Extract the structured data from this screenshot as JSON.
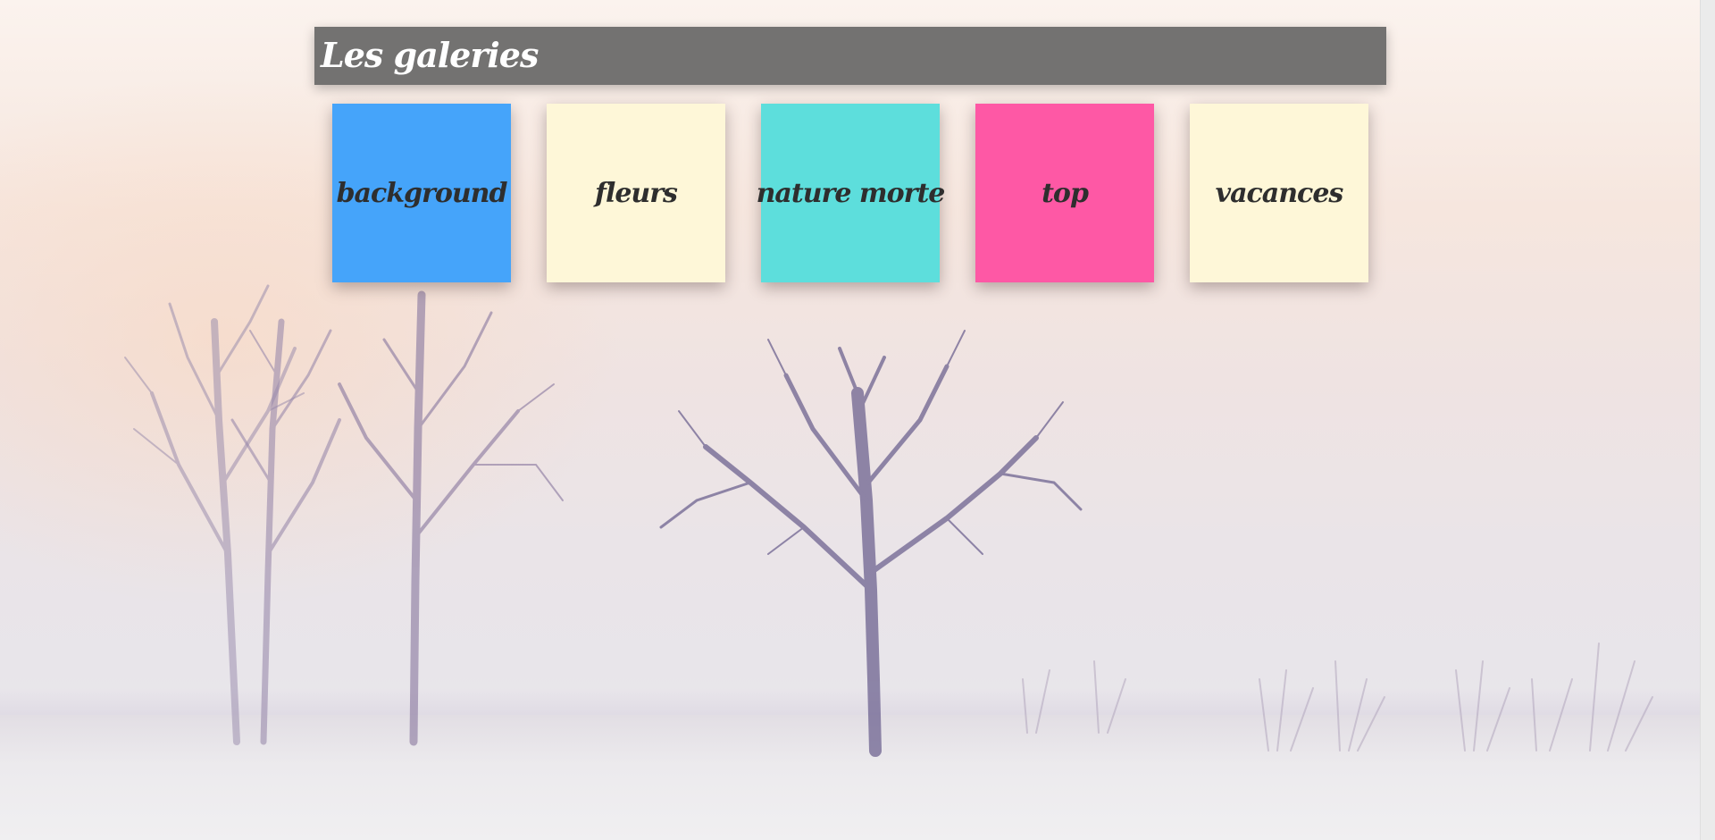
{
  "header": {
    "title": "Les galeries"
  },
  "galleries": [
    {
      "label": "background",
      "color": "#45a4fa"
    },
    {
      "label": "fleurs",
      "color": "#fef7d8"
    },
    {
      "label": "nature morte",
      "color": "#5ddedc"
    },
    {
      "label": "top",
      "color": "#fe58a5"
    },
    {
      "label": "vacances",
      "color": "#fef7d8"
    }
  ],
  "theme": {
    "header_bg": "#737271",
    "tile_text": "#2e2e2e"
  }
}
